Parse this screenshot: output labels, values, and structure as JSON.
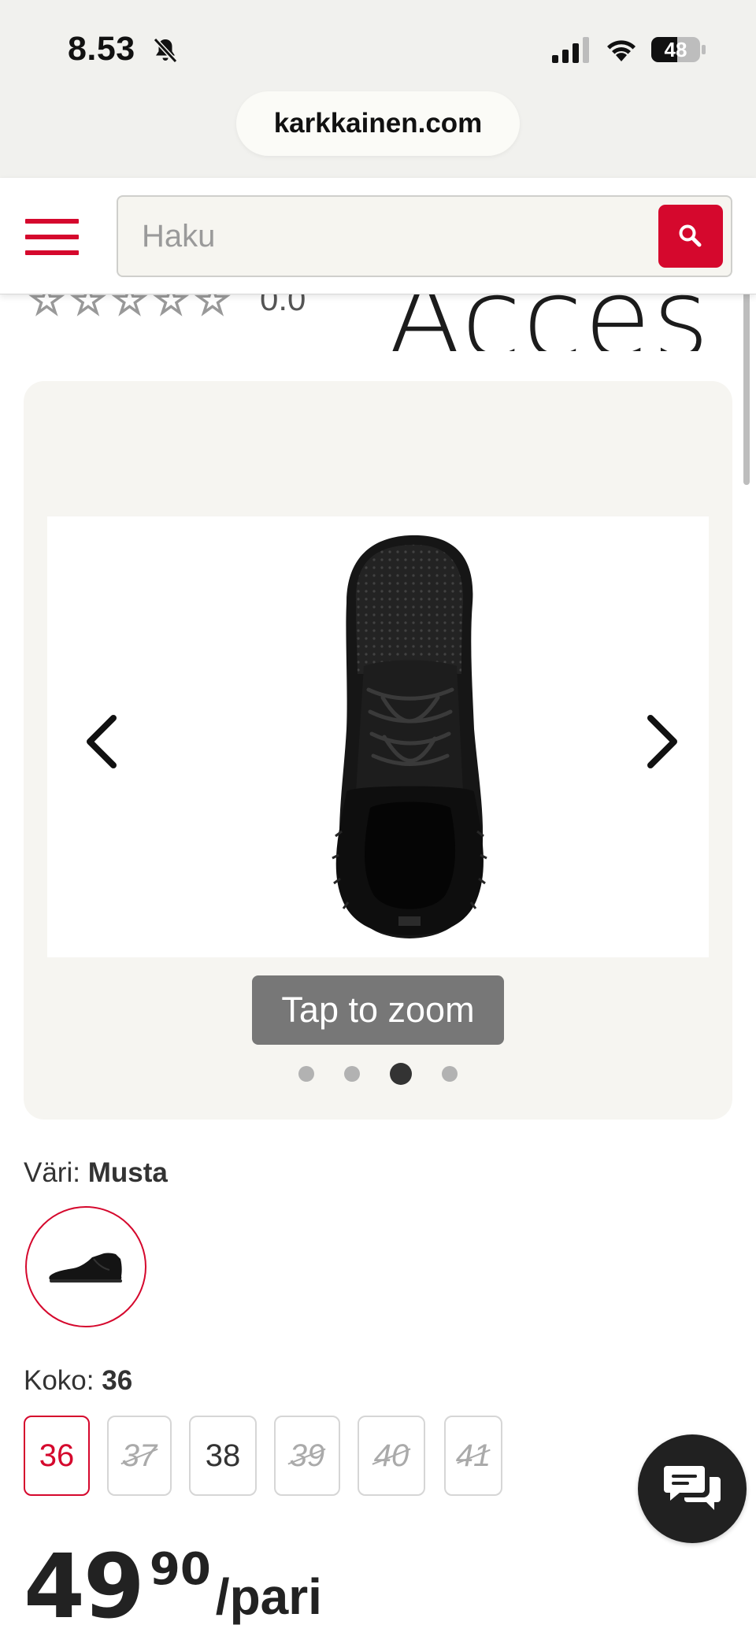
{
  "status_bar": {
    "time": "8.53",
    "battery": "48"
  },
  "browser": {
    "url": "karkkainen.com"
  },
  "header": {
    "search": {
      "placeholder": "Haku"
    }
  },
  "product": {
    "rating_value": "0.0",
    "rating_stars": 0,
    "brand_partial": "Acces",
    "gallery": {
      "zoom_label": "Tap to zoom",
      "image_count": 4,
      "active_index": 2
    },
    "color": {
      "label": "Väri:",
      "value": "Musta"
    },
    "size": {
      "label": "Koko:",
      "value": "36",
      "options": [
        {
          "label": "36",
          "state": "selected"
        },
        {
          "label": "37",
          "state": "unavailable"
        },
        {
          "label": "38",
          "state": "available"
        },
        {
          "label": "39",
          "state": "unavailable"
        },
        {
          "label": "40",
          "state": "unavailable"
        },
        {
          "label": "41",
          "state": "unavailable"
        }
      ]
    },
    "price": {
      "integer": "49",
      "decimal": "90",
      "unit": "/pari"
    }
  },
  "colors": {
    "brand_red": "#d5082d",
    "status_bar_bg": "#f1f1ee",
    "gallery_bg": "#f6f5f1",
    "chat_bg": "#212121"
  }
}
